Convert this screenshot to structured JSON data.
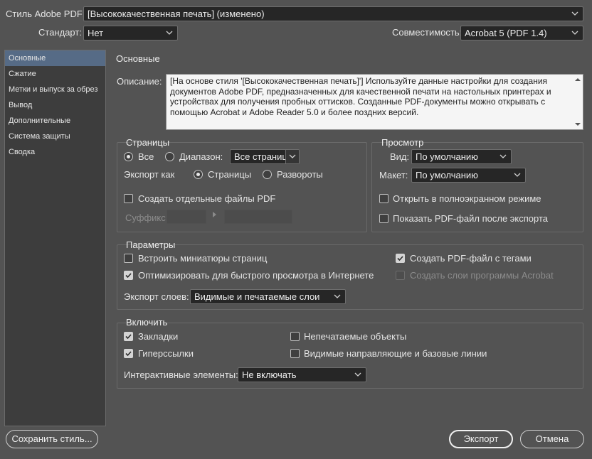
{
  "header": {
    "preset_label": "Стиль Adobe PDF:",
    "preset_value": "[Высококачественная печать] (изменено)",
    "standard_label": "Стандарт:",
    "standard_value": "Нет",
    "compat_label": "Совместимость:",
    "compat_value": "Acrobat 5 (PDF 1.4)"
  },
  "sidebar": {
    "items": [
      {
        "label": "Основные",
        "active": true
      },
      {
        "label": "Сжатие",
        "active": false
      },
      {
        "label": "Метки и выпуск за обрез",
        "active": false
      },
      {
        "label": "Вывод",
        "active": false
      },
      {
        "label": "Дополнительные",
        "active": false
      },
      {
        "label": "Система защиты",
        "active": false
      },
      {
        "label": "Сводка",
        "active": false
      }
    ]
  },
  "main": {
    "section_title": "Основные",
    "description_label": "Описание:",
    "description_text": "[На основе стиля '[Высококачественная печать]'] Используйте данные настройки для создания документов Adobe PDF, предназначенных для качественной печати на настольных принтерах и устройствах для получения пробных оттисков.  Созданные PDF-документы можно  открывать с помощью Acrobat и Adobe Reader 5.0 и более поздних версий."
  },
  "pages": {
    "title": "Страницы",
    "all_label": "Все",
    "all_checked": true,
    "range_label": "Диапазон:",
    "range_checked": false,
    "range_value": "Все страницы",
    "export_as_label": "Экспорт как",
    "pages_label": "Страницы",
    "pages_checked": true,
    "spreads_label": "Развороты",
    "spreads_checked": false,
    "separate_files_label": "Создать отдельные файлы PDF",
    "separate_files_checked": false,
    "suffix_label": "Суффикс:"
  },
  "view": {
    "title": "Просмотр",
    "view_label": "Вид:",
    "view_value": "По умолчанию",
    "layout_label": "Макет:",
    "layout_value": "По умолчанию",
    "fullscreen_label": "Открыть в полноэкранном режиме",
    "fullscreen_checked": false,
    "show_after_export_label": "Показать PDF-файл после экспорта",
    "show_after_export_checked": false
  },
  "options": {
    "title": "Параметры",
    "embed_thumbs_label": "Встроить миниатюры страниц",
    "embed_thumbs_checked": false,
    "optimize_label": "Оптимизировать для быстрого просмотра в Интернете",
    "optimize_checked": true,
    "tagged_label": "Создать PDF-файл с тегами",
    "tagged_checked": true,
    "acrobat_layers_label": "Создать слои программы Acrobat",
    "acrobat_layers_checked": false,
    "export_layers_label": "Экспорт слоев:",
    "export_layers_value": "Видимые и печатаемые слои"
  },
  "include": {
    "title": "Включить",
    "bookmarks_label": "Закладки",
    "bookmarks_checked": true,
    "hyperlinks_label": "Гиперссылки",
    "hyperlinks_checked": true,
    "nonprinting_label": "Непечатаемые объекты",
    "nonprinting_checked": false,
    "guides_label": "Видимые направляющие и базовые линии",
    "guides_checked": false,
    "interactive_label": "Интерактивные элементы:",
    "interactive_value": "Не включать"
  },
  "footer": {
    "save_preset": "Сохранить стиль...",
    "export": "Экспорт",
    "cancel": "Отмена"
  }
}
